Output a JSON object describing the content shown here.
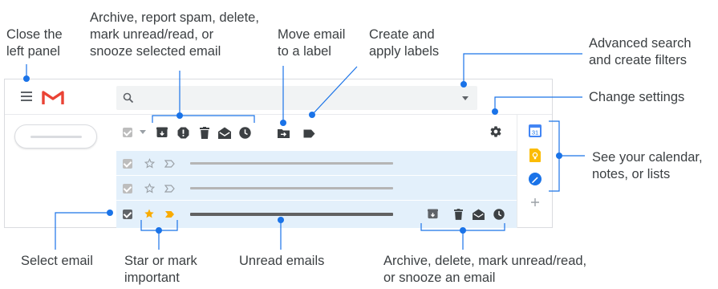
{
  "callouts": {
    "close_panel": "Close the\nleft panel",
    "archive_selected": "Archive, report spam, delete,\nmark unread/read, or\nsnooze selected email",
    "move_email": "Move email\nto a label",
    "create_labels": "Create and\napply labels",
    "advanced_search": "Advanced search\nand create filters",
    "change_settings": "Change settings",
    "see_calendar": "See your calendar,\nnotes, or lists",
    "select_email": "Select email",
    "star_important": "Star or mark\nimportant",
    "unread_emails": "Unread emails",
    "archive_single": "Archive, delete, mark unread/read,\nor snooze an email"
  },
  "colors": {
    "accent_blue": "#1a73e8",
    "list_background": "#e3f0fb",
    "star": "#f9ab00",
    "important": "#f9ab00",
    "gmail_red": "#ea4335"
  },
  "icons": {
    "menu": "menu-icon",
    "logo": "gmail-logo-icon",
    "search": "search-icon",
    "settings": "gear-icon",
    "calendar": "calendar-icon",
    "keep": "keep-icon",
    "tasks": "tasks-icon",
    "add": "plus-icon",
    "calendar_day": "31"
  },
  "rows": [
    {
      "state": "read",
      "selected": true,
      "starred": false,
      "important": false
    },
    {
      "state": "read",
      "selected": true,
      "starred": false,
      "important": false
    },
    {
      "state": "unread",
      "selected": true,
      "starred": true,
      "important": true
    }
  ]
}
